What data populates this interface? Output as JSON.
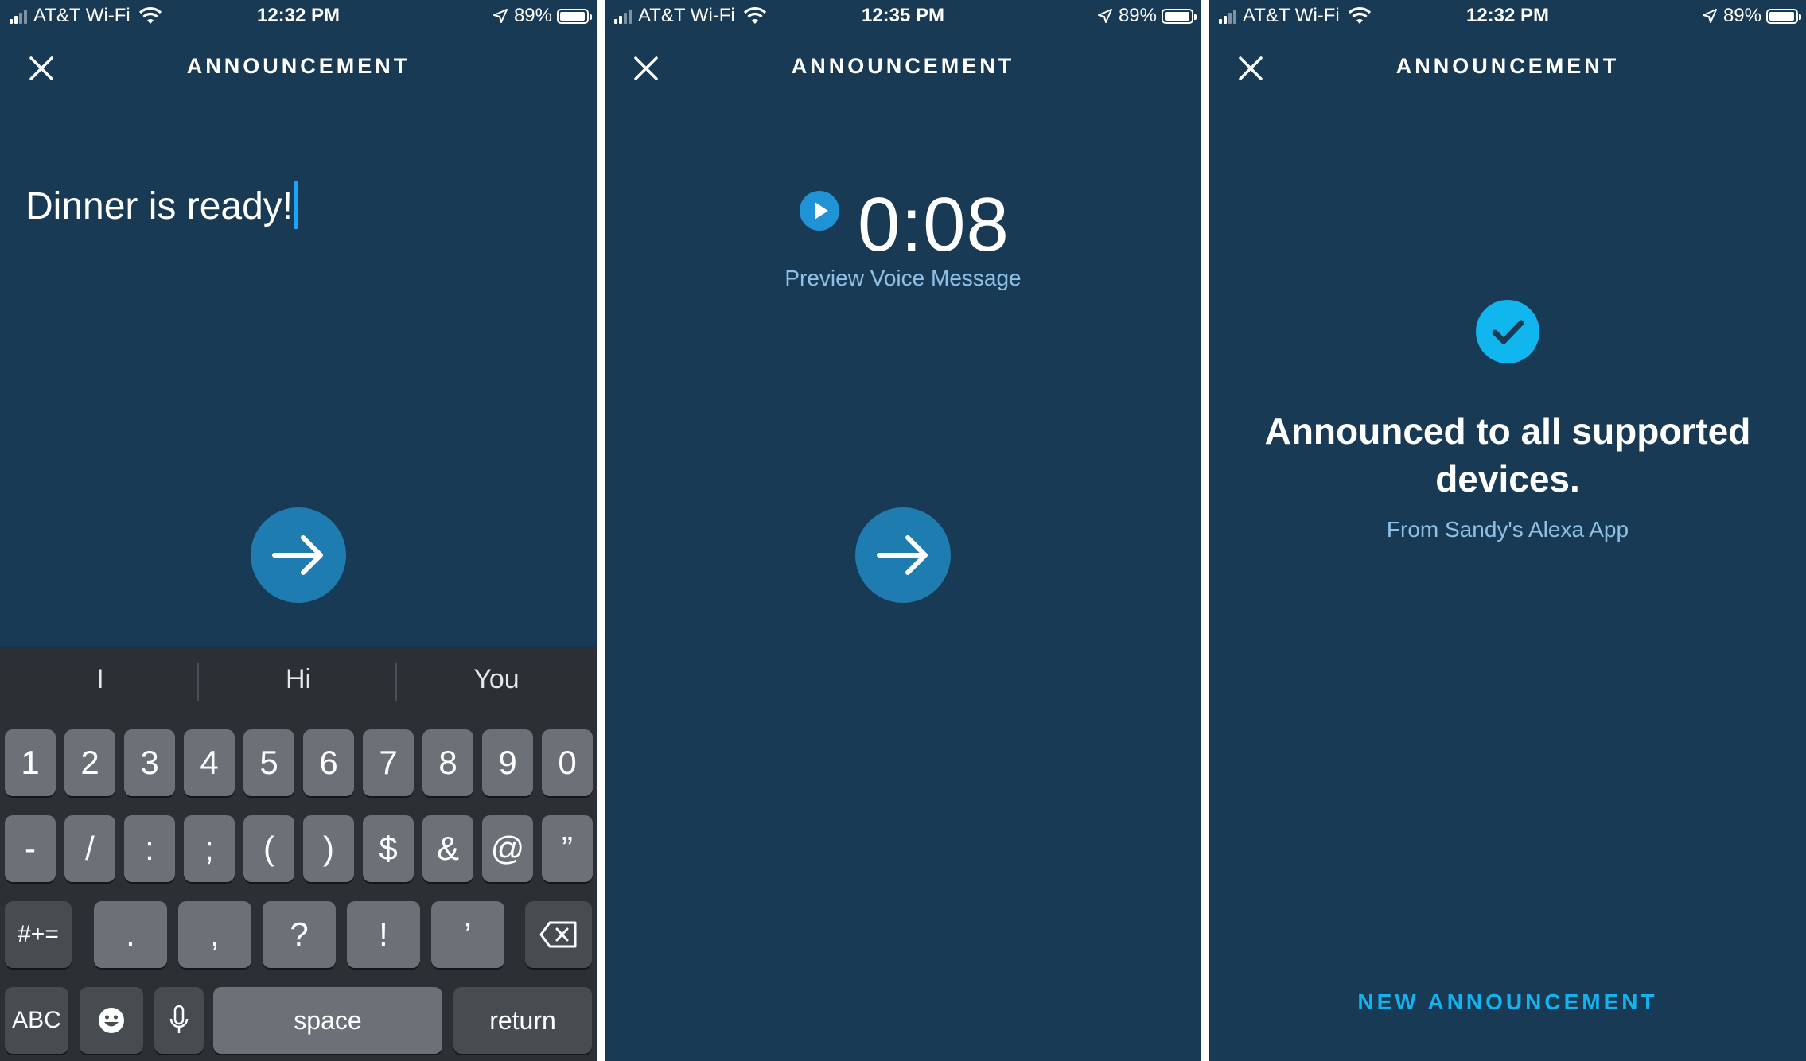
{
  "colors": {
    "panel_bg": "#193a55",
    "accent": "#1f7cb0",
    "check": "#12b6ee",
    "link": "#14b3ee",
    "caret": "#1aa3ff"
  },
  "panels": [
    {
      "status": {
        "carrier": "AT&T Wi-Fi",
        "time": "12:32 PM",
        "battery": "89%",
        "battery_level": 0.89
      },
      "header": {
        "title": "ANNOUNCEMENT",
        "close_icon": "close-icon"
      },
      "message_text": "Dinner is ready!",
      "send_icon": "arrow-right-icon",
      "keyboard": {
        "suggestions": [
          "I",
          "Hi",
          "You"
        ],
        "row1": [
          "1",
          "2",
          "3",
          "4",
          "5",
          "6",
          "7",
          "8",
          "9",
          "0"
        ],
        "row2": [
          "-",
          "/",
          ":",
          ";",
          "(",
          ")",
          "$",
          "&",
          "@",
          "”"
        ],
        "row3_mode": "#+=",
        "row3": [
          ".",
          ",",
          "?",
          "!",
          "’"
        ],
        "backspace_icon": "backspace-icon",
        "abc": "ABC",
        "emoji_icon": "emoji-icon",
        "mic_icon": "microphone-icon",
        "space": "space",
        "return": "return"
      }
    },
    {
      "status": {
        "carrier": "AT&T Wi-Fi",
        "time": "12:35 PM",
        "battery": "89%",
        "battery_level": 0.89
      },
      "header": {
        "title": "ANNOUNCEMENT",
        "close_icon": "close-icon"
      },
      "duration": "0:08",
      "preview_label": "Preview Voice Message",
      "play_icon": "play-icon",
      "send_icon": "arrow-right-icon"
    },
    {
      "status": {
        "carrier": "AT&T Wi-Fi",
        "time": "12:32 PM",
        "battery": "89%",
        "battery_level": 0.89
      },
      "header": {
        "title": "ANNOUNCEMENT",
        "close_icon": "close-icon"
      },
      "check_icon": "checkmark-icon",
      "confirmation": "Announced to all supported devices.",
      "from_text": "From Sandy's Alexa App",
      "new_announcement": "NEW ANNOUNCEMENT"
    }
  ]
}
